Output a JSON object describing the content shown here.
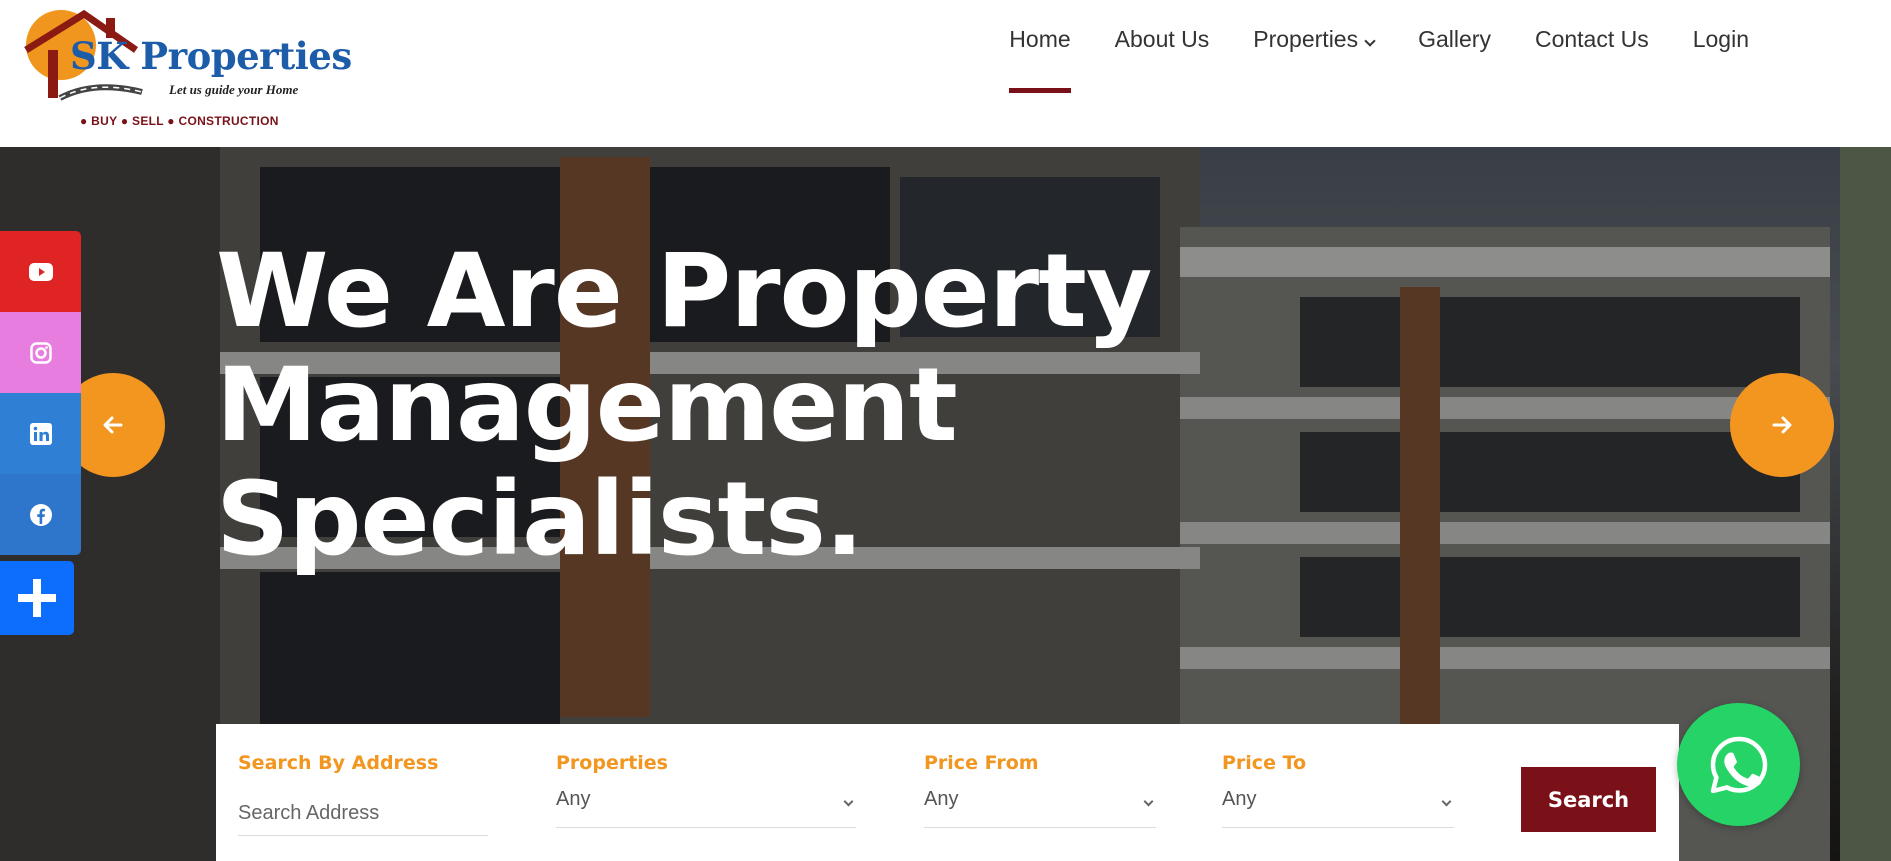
{
  "brand": {
    "name": "SK Properties",
    "tagline": "Let us guide your Home",
    "services": "● BUY ● SELL ● CONSTRUCTION",
    "colors": {
      "primary": "#1c5ca8",
      "accent": "#f2961f",
      "maroon": "#7a1118"
    }
  },
  "nav": {
    "items": [
      {
        "label": "Home",
        "active": true
      },
      {
        "label": "About Us"
      },
      {
        "label": "Properties",
        "has_dropdown": true
      },
      {
        "label": "Gallery"
      },
      {
        "label": "Contact Us"
      },
      {
        "label": "Login"
      }
    ]
  },
  "hero": {
    "title_lines": [
      "We Are Property",
      "Management",
      "Specialists."
    ],
    "prev_icon": "arrow-left-icon",
    "next_icon": "arrow-right-icon"
  },
  "social": {
    "items": [
      {
        "icon": "youtube-icon",
        "color": "#e02424"
      },
      {
        "icon": "instagram-icon",
        "color": "#e87de0"
      },
      {
        "icon": "linkedin-icon",
        "color": "#2f7fd4"
      },
      {
        "icon": "facebook-icon",
        "color": "#2e76cc"
      }
    ],
    "share_icon": "plus-icon"
  },
  "search": {
    "address_label": "Search By Address",
    "address_placeholder": "Search Address",
    "properties_label": "Properties",
    "properties_value": "Any",
    "price_from_label": "Price From",
    "price_from_value": "Any",
    "price_to_label": "Price To",
    "price_to_value": "Any",
    "button_label": "Search"
  },
  "whatsapp": {
    "icon": "whatsapp-icon",
    "color": "#25d366"
  }
}
